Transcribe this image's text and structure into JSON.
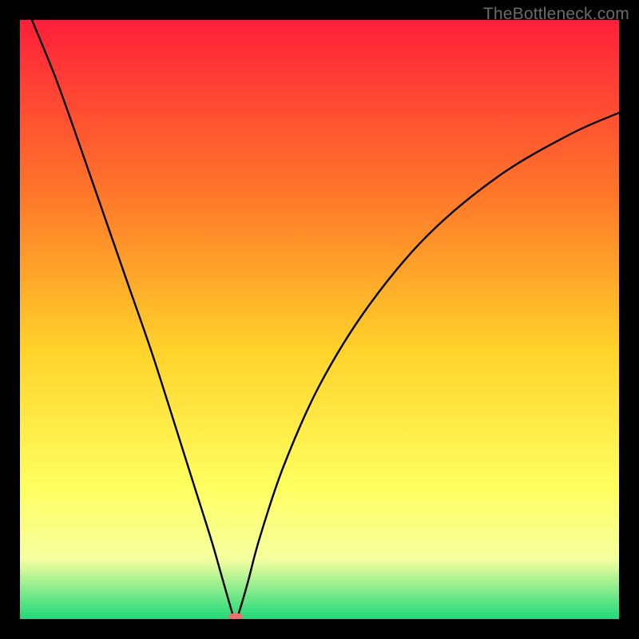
{
  "watermark": "TheBottleneck.com",
  "chart_data": {
    "type": "line",
    "title": "",
    "xlabel": "",
    "ylabel": "",
    "xlim": [
      0,
      1
    ],
    "ylim": [
      0,
      1
    ],
    "background_gradient": {
      "top": "#ff1f3a",
      "mid1": "#ff7a2a",
      "mid2": "#ffd22a",
      "mid3": "#ffff60",
      "mid4": "#f6ffa0",
      "bottom": "#1ed97a",
      "stops": [
        0.0,
        0.3,
        0.55,
        0.78,
        0.9,
        1.0
      ]
    },
    "series": [
      {
        "name": "bottleneck-curve",
        "x": [
          0.02,
          0.06,
          0.1,
          0.14,
          0.18,
          0.22,
          0.26,
          0.29,
          0.32,
          0.34,
          0.356,
          0.36,
          0.364,
          0.38,
          0.4,
          0.44,
          0.5,
          0.58,
          0.68,
          0.8,
          0.92,
          1.0
        ],
        "y": [
          1.0,
          0.902,
          0.79,
          0.675,
          0.56,
          0.445,
          0.32,
          0.225,
          0.13,
          0.06,
          0.005,
          0.0,
          0.006,
          0.06,
          0.135,
          0.255,
          0.39,
          0.52,
          0.64,
          0.74,
          0.81,
          0.845
        ]
      }
    ],
    "marker": {
      "x": 0.36,
      "y": 0.0,
      "rx": 0.012,
      "ry": 0.006,
      "color": "#ef6e6e"
    }
  }
}
